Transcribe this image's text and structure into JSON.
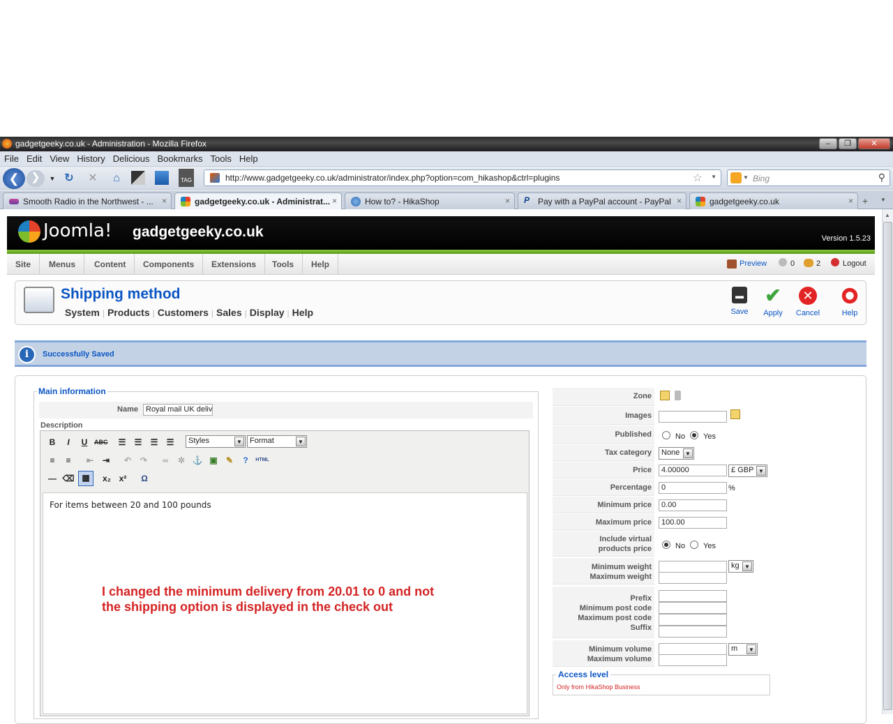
{
  "browser": {
    "window_title": "gadgetgeeky.co.uk - Administration - Mozilla Firefox",
    "menu": [
      "File",
      "Edit",
      "View",
      "History",
      "Delicious",
      "Bookmarks",
      "Tools",
      "Help"
    ],
    "url": "http://www.gadgetgeeky.co.uk/administrator/index.php?option=com_hikashop&ctrl=plugins",
    "search_placeholder": "Bing",
    "tabs": [
      {
        "label": "Smooth Radio in the Northwest - ...",
        "active": false
      },
      {
        "label": "gadgetgeeky.co.uk - Administrat...",
        "active": true
      },
      {
        "label": "How to? - HikaShop",
        "active": false
      },
      {
        "label": "Pay with a PayPal account - PayPal",
        "active": false
      },
      {
        "label": "gadgetgeeky.co.uk",
        "active": false
      }
    ],
    "close_glyph": "×"
  },
  "joomla": {
    "logo": "Joomla!",
    "site_name": "gadgetgeeky.co.uk",
    "version": "Version 1.5.23",
    "menu": [
      "Site",
      "Menus",
      "Content",
      "Components",
      "Extensions",
      "Tools",
      "Help"
    ],
    "status": {
      "preview": "Preview",
      "messages": "0",
      "users": "2",
      "logout": "Logout"
    }
  },
  "page": {
    "title": "Shipping method",
    "submenu": [
      "System",
      "Products",
      "Customers",
      "Sales",
      "Display",
      "Help"
    ],
    "toolbar": {
      "save": "Save",
      "apply": "Apply",
      "cancel": "Cancel",
      "help": "Help"
    },
    "message": "Successfully Saved"
  },
  "main_info": {
    "legend": "Main information",
    "name_label": "Name",
    "name_value": "Royal mail UK delivery",
    "description_label": "Description",
    "styles": "Styles",
    "format": "Format",
    "description_text": "For items between 20 and 100 pounds",
    "annotation_line1": "I changed the minimum delivery from 20.01 to 0 and not",
    "annotation_line2": "the shipping option is displayed in the check out",
    "html_btn": "HTML"
  },
  "params": {
    "zone": "Zone",
    "images": "Images",
    "published": "Published",
    "no": "No",
    "yes": "Yes",
    "tax_category": "Tax category",
    "tax_value": "None",
    "price": "Price",
    "price_value": "4.00000",
    "currency": "£ GBP",
    "percentage": "Percentage",
    "percentage_value": "0",
    "percent_sign": "%",
    "min_price": "Minimum price",
    "min_price_value": "0.00",
    "max_price": "Maximum price",
    "max_price_value": "100.00",
    "include_virtual_1": "Include virtual",
    "include_virtual_2": "products price",
    "min_weight": "Minimum weight",
    "max_weight": "Maximum weight",
    "weight_unit": "kg",
    "prefix": "Prefix",
    "min_post": "Minimum post code",
    "max_post": "Maximum post code",
    "suffix": "Suffix",
    "min_volume": "Minimum volume",
    "max_volume": "Maximum volume",
    "volume_unit": "m",
    "access_legend": "Access level",
    "access_value": "Only from HikaShop Business"
  },
  "colors": {
    "joomla_blue": "#0b55c4",
    "annotation_red": "#d42323",
    "green_bar": "#6aaa2a"
  }
}
